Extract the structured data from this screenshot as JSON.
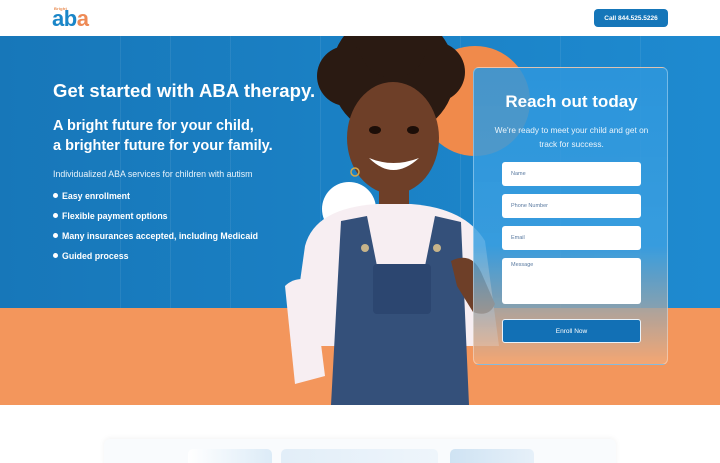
{
  "header": {
    "logo_small": "Bright",
    "logo_text_a1": "a",
    "logo_text_b": "b",
    "logo_text_a2": "a",
    "call_label": "Call 844.525.5226"
  },
  "hero": {
    "title": "Get started with ABA therapy.",
    "subtitle_line1": "A bright future for your child,",
    "subtitle_line2": "a brighter future for your family.",
    "description": "Individualized ABA services for children with autism",
    "bullets": [
      "Easy enrollment",
      "Flexible payment options",
      "Many insurances accepted, including Medicaid",
      "Guided process"
    ]
  },
  "form": {
    "title": "Reach out today",
    "subtitle": "We're ready to meet your child and get on track for success.",
    "name_placeholder": "Name",
    "phone_placeholder": "Phone Number",
    "email_placeholder": "Email",
    "message_placeholder": "Message",
    "submit_label": "Enroll Now"
  },
  "colors": {
    "brand_blue": "#1a7dc0",
    "accent_orange": "#f3965c",
    "button_blue": "#1270b5"
  }
}
